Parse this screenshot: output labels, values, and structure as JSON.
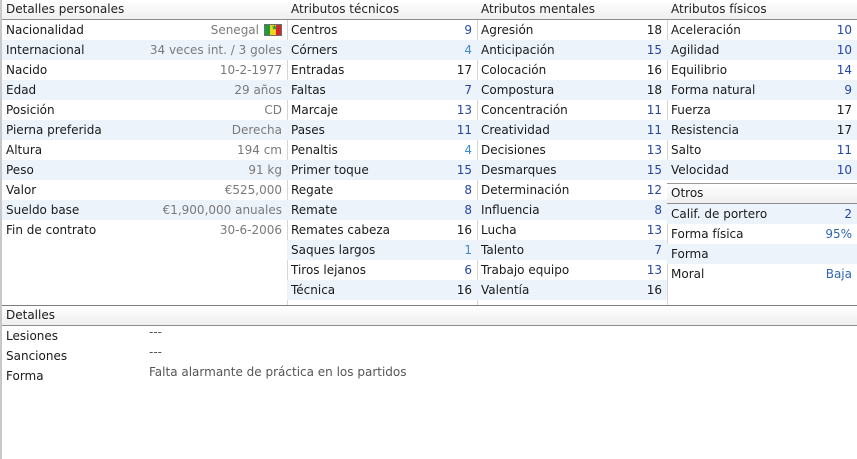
{
  "personal": {
    "title": "Detalles personales",
    "rows": [
      {
        "label": "Nacionalidad",
        "value": "Senegal"
      },
      {
        "label": "Internacional",
        "value": "34 veces int. / 3 goles"
      },
      {
        "label": "Nacido",
        "value": "10-2-1977"
      },
      {
        "label": "Edad",
        "value": "29 años"
      },
      {
        "label": "Posición",
        "value": "CD"
      },
      {
        "label": "Pierna preferida",
        "value": "Derecha"
      },
      {
        "label": "Altura",
        "value": "194 cm"
      },
      {
        "label": "Peso",
        "value": "91 kg"
      },
      {
        "label": "Valor",
        "value": "€525,000"
      },
      {
        "label": "Sueldo base",
        "value": "€1,900,000 anuales"
      },
      {
        "label": "Fin de contrato",
        "value": "30-6-2006"
      }
    ],
    "flag_colors": [
      "#1f9b3d",
      "#f3d41c",
      "#d8232a"
    ]
  },
  "technical": {
    "title": "Atributos técnicos",
    "rows": [
      {
        "label": "Centros",
        "value": "9"
      },
      {
        "label": "Córners",
        "value": "4"
      },
      {
        "label": "Entradas",
        "value": "17"
      },
      {
        "label": "Faltas",
        "value": "7"
      },
      {
        "label": "Marcaje",
        "value": "13"
      },
      {
        "label": "Pases",
        "value": "11"
      },
      {
        "label": "Penaltis",
        "value": "4"
      },
      {
        "label": "Primer toque",
        "value": "15"
      },
      {
        "label": "Regate",
        "value": "8"
      },
      {
        "label": "Remate",
        "value": "8"
      },
      {
        "label": "Remates cabeza",
        "value": "16"
      },
      {
        "label": "Saques largos",
        "value": "1"
      },
      {
        "label": "Tiros lejanos",
        "value": "6"
      },
      {
        "label": "Técnica",
        "value": "16"
      }
    ]
  },
  "mental": {
    "title": "Atributos mentales",
    "rows": [
      {
        "label": "Agresión",
        "value": "18"
      },
      {
        "label": "Anticipación",
        "value": "15"
      },
      {
        "label": "Colocación",
        "value": "16"
      },
      {
        "label": "Compostura",
        "value": "18"
      },
      {
        "label": "Concentración",
        "value": "11"
      },
      {
        "label": "Creatividad",
        "value": "11"
      },
      {
        "label": "Decisiones",
        "value": "13"
      },
      {
        "label": "Desmarques",
        "value": "15"
      },
      {
        "label": "Determinación",
        "value": "12"
      },
      {
        "label": "Influencia",
        "value": "8"
      },
      {
        "label": "Lucha",
        "value": "13"
      },
      {
        "label": "Talento",
        "value": "7"
      },
      {
        "label": "Trabajo equipo",
        "value": "13"
      },
      {
        "label": "Valentía",
        "value": "16"
      }
    ]
  },
  "physical": {
    "title": "Atributos físicos",
    "rows": [
      {
        "label": "Aceleración",
        "value": "10"
      },
      {
        "label": "Agilidad",
        "value": "10"
      },
      {
        "label": "Equilibrio",
        "value": "14"
      },
      {
        "label": "Forma natural",
        "value": "9"
      },
      {
        "label": "Fuerza",
        "value": "17"
      },
      {
        "label": "Resistencia",
        "value": "17"
      },
      {
        "label": "Salto",
        "value": "11"
      },
      {
        "label": "Velocidad",
        "value": "10"
      }
    ]
  },
  "others": {
    "title": "Otros",
    "rows": [
      {
        "label": "Calif. de portero",
        "value": "2"
      },
      {
        "label": "Forma física",
        "value": "95%"
      },
      {
        "label": "Forma",
        "value": ""
      },
      {
        "label": "Moral",
        "value": "Baja"
      }
    ]
  },
  "details": {
    "title": "Detalles",
    "rows": [
      {
        "label": "Lesiones",
        "value": "---"
      },
      {
        "label": "Sanciones",
        "value": "---"
      },
      {
        "label": "Forma",
        "value": "Falta alarmante de práctica en los partidos"
      }
    ]
  }
}
